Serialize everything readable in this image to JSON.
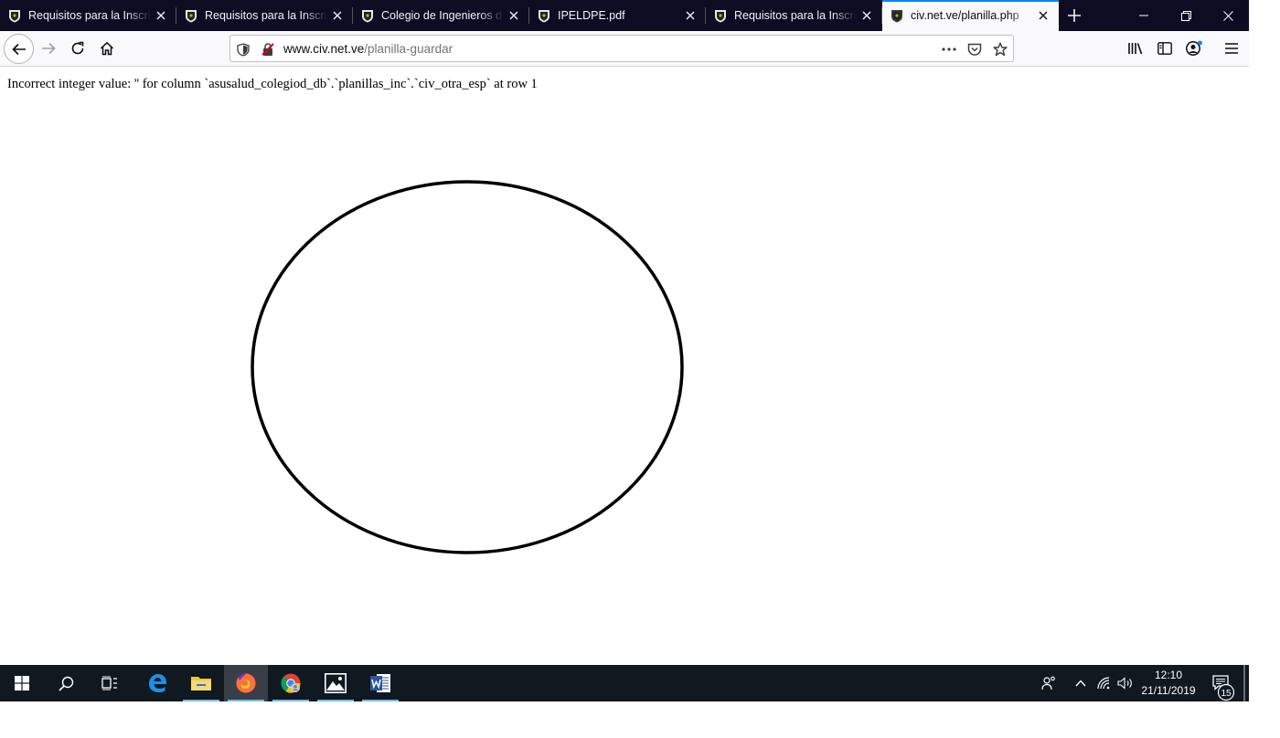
{
  "browser": {
    "tabs": [
      {
        "title": "Requisitos para la Inscripción",
        "icon": "shield-favicon-icon",
        "active": false
      },
      {
        "title": "Requisitos para la Inscripción",
        "icon": "shield-favicon-icon",
        "active": false
      },
      {
        "title": "Colegio de Ingenieros de Venezuela",
        "icon": "shield-favicon-icon",
        "active": false
      },
      {
        "title": "IPELDPE.pdf",
        "icon": "shield-favicon-icon",
        "active": false
      },
      {
        "title": "Requisitos para la Inscripción",
        "icon": "shield-favicon-icon",
        "active": false
      },
      {
        "title": "civ.net.ve/planilla.php",
        "icon": "shield-favicon-icon",
        "active": true
      }
    ],
    "url": {
      "domain": "www.civ.net.ve",
      "path": "/planilla-guardar"
    },
    "accent_color": "#0a84ff"
  },
  "page": {
    "error_message": "Incorrect integer value: '' for column `asusalud_colegiod_db`.`planillas_inc`.`civ_otra_esp` at row 1"
  },
  "taskbar": {
    "apps": [
      "start-icon",
      "search-icon",
      "task-view-icon",
      "edge-icon",
      "file-explorer-icon",
      "firefox-icon",
      "chrome-icon",
      "photos-icon",
      "word-icon"
    ],
    "clock_time": "12:10",
    "clock_date": "21/11/2019",
    "notification_count": "15"
  }
}
